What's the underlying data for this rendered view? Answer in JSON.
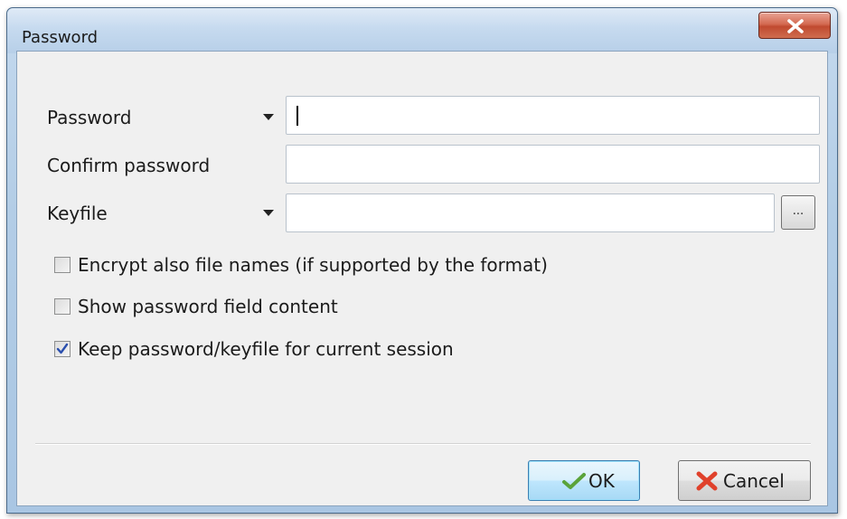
{
  "window": {
    "title": "Password"
  },
  "form": {
    "password": {
      "label": "Password",
      "value": ""
    },
    "confirm": {
      "label": "Confirm password",
      "value": ""
    },
    "keyfile": {
      "label": "Keyfile",
      "value": "",
      "browse_label": "..."
    }
  },
  "options": [
    {
      "label": "Encrypt also file names (if supported by the format)",
      "checked": false
    },
    {
      "label": "Show password field content",
      "checked": false
    },
    {
      "label": "Keep password/keyfile for current session",
      "checked": true
    }
  ],
  "buttons": {
    "ok_label": "OK",
    "cancel_label": "Cancel"
  },
  "colors": {
    "check_mark": "#2b4fae",
    "ok_icon": "#5aa33a",
    "cancel_icon": "#e0412b"
  },
  "icons": {
    "close": "close-icon",
    "dropdown": "dropdown-arrow-icon",
    "check": "checkmark-icon",
    "ok": "green-check-icon",
    "cancel": "red-x-icon"
  }
}
